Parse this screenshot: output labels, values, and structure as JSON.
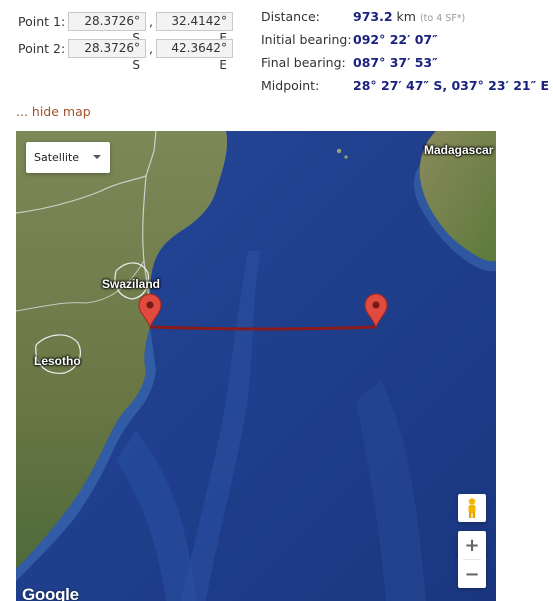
{
  "points": {
    "p1": {
      "label": "Point 1:",
      "lat": "28.3726° S",
      "lon": "32.4142° E"
    },
    "p2": {
      "label": "Point 2:",
      "lat": "28.3726° S",
      "lon": "42.3642° E"
    },
    "separator": ","
  },
  "results": {
    "distance": {
      "label": "Distance:",
      "value": "973.2",
      "unit": "km",
      "note": "(to 4 SF*)"
    },
    "initial_bearing": {
      "label": "Initial bearing:",
      "value": "092° 22′ 07″"
    },
    "final_bearing": {
      "label": "Final bearing:",
      "value": "087° 37′ 53″"
    },
    "midpoint": {
      "label": "Midpoint:",
      "value": "28° 27′ 47″ S, 037° 23′ 21″ E"
    }
  },
  "hide_map_link": "... hide map",
  "map": {
    "type_selector": "Satellite",
    "labels": {
      "madagascar": "Madagascar",
      "swaziland": "Swaziland",
      "lesotho": "Lesotho"
    },
    "zoom_in": "+",
    "zoom_out": "−",
    "logo": "Google",
    "colors": {
      "ocean": "#1e3d8a",
      "land": "#6b7a4a",
      "route": "#8b1a1a",
      "marker": "#e04a3f"
    },
    "icons": {
      "marker": "map-pin-icon",
      "pegman": "pegman-icon"
    }
  }
}
